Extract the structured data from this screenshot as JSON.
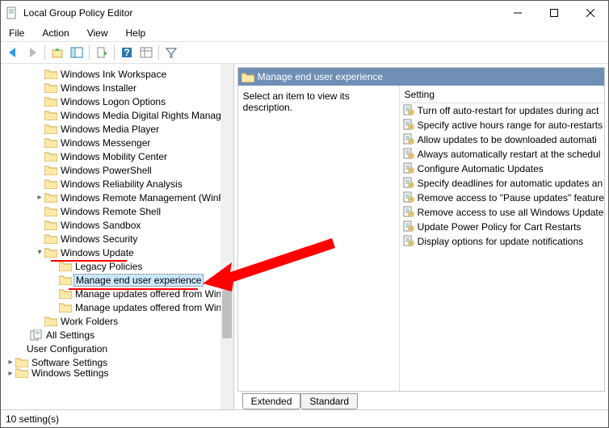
{
  "window": {
    "title": "Local Group Policy Editor"
  },
  "menu": {
    "file": "File",
    "action": "Action",
    "view": "View",
    "help": "Help"
  },
  "tree": {
    "items": [
      {
        "indent": 42,
        "exp": "",
        "label": "Windows Ink Workspace"
      },
      {
        "indent": 42,
        "exp": "",
        "label": "Windows Installer"
      },
      {
        "indent": 42,
        "exp": "",
        "label": "Windows Logon Options"
      },
      {
        "indent": 42,
        "exp": "",
        "label": "Windows Media Digital Rights Manage"
      },
      {
        "indent": 42,
        "exp": "",
        "label": "Windows Media Player"
      },
      {
        "indent": 42,
        "exp": "",
        "label": "Windows Messenger"
      },
      {
        "indent": 42,
        "exp": "",
        "label": "Windows Mobility Center"
      },
      {
        "indent": 42,
        "exp": "",
        "label": "Windows PowerShell"
      },
      {
        "indent": 42,
        "exp": "",
        "label": "Windows Reliability Analysis"
      },
      {
        "indent": 42,
        "exp": ">",
        "label": "Windows Remote Management (WinR"
      },
      {
        "indent": 42,
        "exp": "",
        "label": "Windows Remote Shell"
      },
      {
        "indent": 42,
        "exp": "",
        "label": "Windows Sandbox"
      },
      {
        "indent": 42,
        "exp": "",
        "label": "Windows Security"
      },
      {
        "indent": 42,
        "exp": "v",
        "label": "Windows Update",
        "first_underline": true
      },
      {
        "indent": 60,
        "exp": "",
        "label": "Legacy Policies"
      },
      {
        "indent": 60,
        "exp": "",
        "label": "Manage end user experience",
        "selected": true,
        "second_underline": true
      },
      {
        "indent": 60,
        "exp": "",
        "label": "Manage updates offered from Win"
      },
      {
        "indent": 60,
        "exp": "",
        "label": "Manage updates offered from Win"
      },
      {
        "indent": 42,
        "exp": "",
        "label": "Work Folders"
      },
      {
        "indent": 24,
        "exp": "",
        "label": "All Settings",
        "icon": "allsettings"
      },
      {
        "indent": 0,
        "exp": "",
        "label": "User Configuration",
        "icon": "none"
      },
      {
        "indent": 6,
        "exp": ">",
        "label": "Software Settings"
      },
      {
        "indent": 6,
        "exp": ">",
        "label": "Windows Settings",
        "cut": true
      }
    ]
  },
  "main": {
    "title": "Manage end user experience",
    "desc": "Select an item to view its description.",
    "col_header": "Setting",
    "settings": [
      "Turn off auto-restart for updates during act",
      "Specify active hours range for auto-restarts",
      "Allow updates to be downloaded automati",
      "Always automatically restart at the schedul",
      "Configure Automatic Updates",
      "Specify deadlines for automatic updates an",
      "Remove access to \"Pause updates\" feature",
      "Remove access to use all Windows Update",
      "Update Power Policy for Cart Restarts",
      "Display options for update notifications"
    ]
  },
  "tabs": {
    "extended": "Extended",
    "standard": "Standard"
  },
  "status": "10 setting(s)"
}
